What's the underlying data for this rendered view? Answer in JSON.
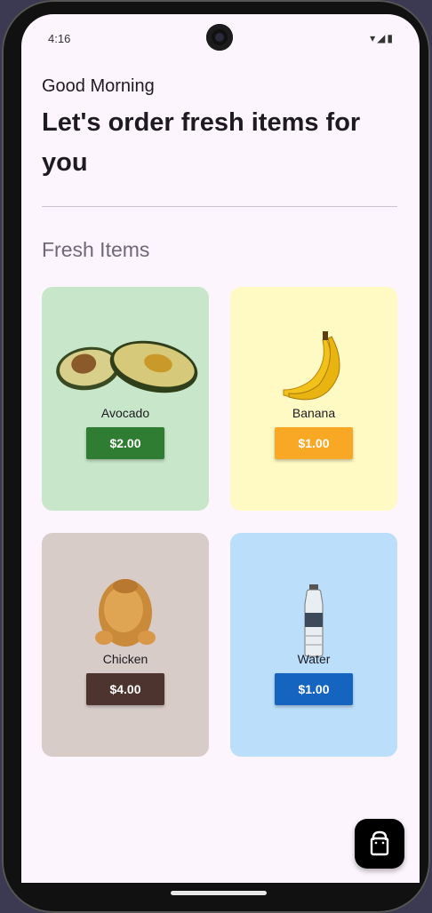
{
  "status": {
    "time": "4:16",
    "icons": "▾◢▮"
  },
  "header": {
    "greeting": "Good Morning",
    "headline": "Let's order fresh items for you"
  },
  "section": {
    "title": "Fresh Items"
  },
  "items": [
    {
      "name": "Avocado",
      "price": "$2.00",
      "icon": "avocado-image",
      "bg": "#c8e6c9",
      "button_color": "#2e7d32"
    },
    {
      "name": "Banana",
      "price": "$1.00",
      "icon": "banana-image",
      "bg": "#fff9c4",
      "button_color": "#f9a825"
    },
    {
      "name": "Chicken",
      "price": "$4.00",
      "icon": "chicken-image",
      "bg": "#d7ccc8",
      "button_color": "#4e342e"
    },
    {
      "name": "Water",
      "price": "$1.00",
      "icon": "water-bottle-image",
      "bg": "#bbdefb",
      "button_color": "#1565c0"
    }
  ],
  "fab": {
    "icon": "shopping-bag-icon"
  }
}
